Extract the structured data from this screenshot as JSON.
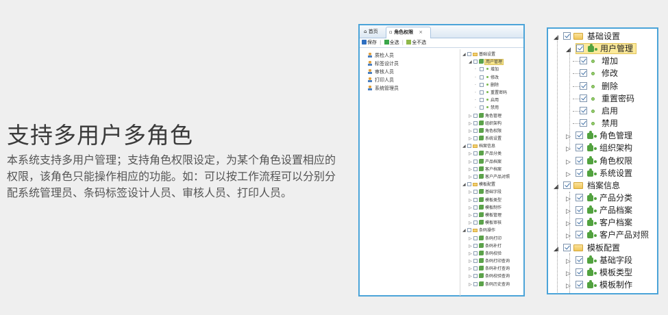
{
  "intro": {
    "title": "支持多用户多角色",
    "body": "本系统支持多用户管理；支持角色权限设定，为某个角色设置相应的权限，该角色只能操作相应的功能。如：可以按工作流程可以分别分配系统管理员、条码标签设计人员、审核人员、打印人员。"
  },
  "window": {
    "tabs": [
      {
        "label": "首页",
        "icon": "home-icon"
      },
      {
        "label": "角色权限",
        "icon": "page-icon",
        "close": "×"
      }
    ],
    "toolbar": [
      {
        "label": "保存",
        "icon": "save-icon"
      },
      {
        "label": "全选",
        "icon": "select-all-icon"
      },
      {
        "label": "全不选",
        "icon": "select-none-icon"
      }
    ],
    "users": [
      "质检人员",
      "标签设计员",
      "审核人员",
      "打印人员",
      "系统管理员"
    ],
    "tree": [
      {
        "level": 0,
        "label": "基础设置",
        "type": "folder"
      },
      {
        "level": 1,
        "label": "用户管理",
        "type": "module",
        "highlighted": true
      },
      {
        "level": 2,
        "label": "增加",
        "type": "action"
      },
      {
        "level": 2,
        "label": "修改",
        "type": "action"
      },
      {
        "level": 2,
        "label": "删除",
        "type": "action"
      },
      {
        "level": 2,
        "label": "重置密码",
        "type": "action"
      },
      {
        "level": 2,
        "label": "启用",
        "type": "action"
      },
      {
        "level": 2,
        "label": "禁用",
        "type": "action"
      },
      {
        "level": 1,
        "label": "角色管理",
        "type": "module"
      },
      {
        "level": 1,
        "label": "组织架构",
        "type": "module"
      },
      {
        "level": 1,
        "label": "角色权限",
        "type": "module"
      },
      {
        "level": 1,
        "label": "系统设置",
        "type": "module"
      },
      {
        "level": 0,
        "label": "档案信息",
        "type": "folder"
      },
      {
        "level": 1,
        "label": "产品分类",
        "type": "module"
      },
      {
        "level": 1,
        "label": "产品档案",
        "type": "module"
      },
      {
        "level": 1,
        "label": "客户档案",
        "type": "module"
      },
      {
        "level": 1,
        "label": "客户产品对照",
        "type": "module"
      },
      {
        "level": 0,
        "label": "模板配置",
        "type": "folder"
      },
      {
        "level": 1,
        "label": "基础字段",
        "type": "module"
      },
      {
        "level": 1,
        "label": "模板类型",
        "type": "module"
      },
      {
        "level": 1,
        "label": "模板制作",
        "type": "module"
      },
      {
        "level": 1,
        "label": "模板管理",
        "type": "module"
      },
      {
        "level": 1,
        "label": "模板审核",
        "type": "module"
      },
      {
        "level": 0,
        "label": "条码操作",
        "type": "folder"
      },
      {
        "level": 1,
        "label": "条码打印",
        "type": "module"
      },
      {
        "level": 1,
        "label": "条码补打",
        "type": "module"
      },
      {
        "level": 1,
        "label": "条码校验",
        "type": "module"
      },
      {
        "level": 1,
        "label": "条码打印查询",
        "type": "module"
      },
      {
        "level": 1,
        "label": "条码补打查询",
        "type": "module"
      },
      {
        "level": 1,
        "label": "条码校验查询",
        "type": "module"
      },
      {
        "level": 1,
        "label": "条码历史查询",
        "type": "module"
      }
    ]
  },
  "zoom_tree": [
    {
      "level": 0,
      "label": "基础设置",
      "type": "folder",
      "expander": "◢"
    },
    {
      "level": 1,
      "label": "用户管理",
      "type": "module",
      "expander": "◢",
      "highlighted": true
    },
    {
      "level": 2,
      "label": "增加",
      "type": "action"
    },
    {
      "level": 2,
      "label": "修改",
      "type": "action"
    },
    {
      "level": 2,
      "label": "删除",
      "type": "action"
    },
    {
      "level": 2,
      "label": "重置密码",
      "type": "action"
    },
    {
      "level": 2,
      "label": "启用",
      "type": "action"
    },
    {
      "level": 2,
      "label": "禁用",
      "type": "action"
    },
    {
      "level": 1,
      "label": "角色管理",
      "type": "module",
      "expander": "▷"
    },
    {
      "level": 1,
      "label": "组织架构",
      "type": "module",
      "expander": "▷"
    },
    {
      "level": 1,
      "label": "角色权限",
      "type": "module",
      "expander": "▷"
    },
    {
      "level": 1,
      "label": "系统设置",
      "type": "module",
      "expander": "▷"
    },
    {
      "level": 0,
      "label": "档案信息",
      "type": "folder",
      "expander": "◢"
    },
    {
      "level": 1,
      "label": "产品分类",
      "type": "module",
      "expander": "▷"
    },
    {
      "level": 1,
      "label": "产品档案",
      "type": "module",
      "expander": "▷"
    },
    {
      "level": 1,
      "label": "客户档案",
      "type": "module",
      "expander": "▷"
    },
    {
      "level": 1,
      "label": "客户产品对照",
      "type": "module",
      "expander": "▷"
    },
    {
      "level": 0,
      "label": "模板配置",
      "type": "folder",
      "expander": "◢"
    },
    {
      "level": 1,
      "label": "基础字段",
      "type": "module",
      "expander": "▷"
    },
    {
      "level": 1,
      "label": "模板类型",
      "type": "module",
      "expander": "▷"
    },
    {
      "level": 1,
      "label": "模板制作",
      "type": "module",
      "expander": "▷"
    }
  ],
  "colors": {
    "frame_border": "#4aa3d8",
    "highlight": "#fbe99a",
    "page_bg": "#efefef"
  }
}
